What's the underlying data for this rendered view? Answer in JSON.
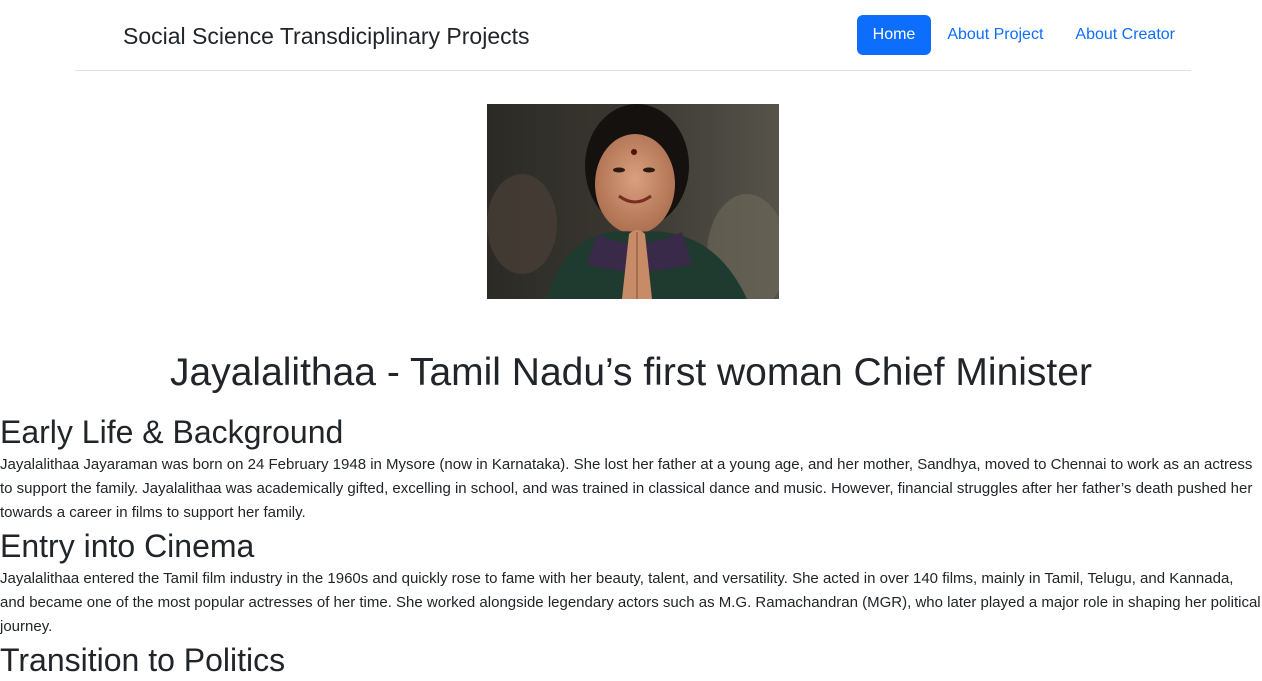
{
  "navbar": {
    "brand": "Social Science Transdiciplinary Projects",
    "links": [
      {
        "label": "Home",
        "active": true
      },
      {
        "label": "About Project",
        "active": false
      },
      {
        "label": "About Creator",
        "active": false
      }
    ]
  },
  "hero_image": {
    "alt": "Jayalalithaa"
  },
  "page_title": "Jayalalithaa - Tamil Nadu’s first woman Chief Minister",
  "sections": [
    {
      "heading": "Early Life & Background",
      "body": "Jayalalithaa Jayaraman was born on 24 February 1948 in Mysore (now in Karnataka). She lost her father at a young age, and her mother, Sandhya, moved to Chennai to work as an actress to support the family. Jayalalithaa was academically gifted, excelling in school, and was trained in classical dance and music. However, financial struggles after her father’s death pushed her towards a career in films to support her family."
    },
    {
      "heading": "Entry into Cinema",
      "body": "Jayalalithaa entered the Tamil film industry in the 1960s and quickly rose to fame with her beauty, talent, and versatility. She acted in over 140 films, mainly in Tamil, Telugu, and Kannada, and became one of the most popular actresses of her time. She worked alongside legendary actors such as M.G. Ramachandran (MGR), who later played a major role in shaping her political journey."
    },
    {
      "heading": "Transition to Politics",
      "body": ""
    }
  ],
  "colors": {
    "primary": "#0d6efd",
    "text": "#212529",
    "divider": "#dee2e6"
  }
}
